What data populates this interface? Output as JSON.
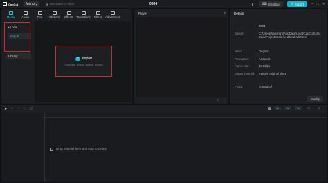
{
  "app": {
    "name": "CapCut",
    "menu_label": "Menu",
    "autosave_text": "Auto saved: 17:58:52",
    "project_title": "0504",
    "shortcut_label": "Shortcut",
    "export_label": "Export"
  },
  "media_tabs": [
    {
      "label": "Media",
      "icon": "media-icon"
    },
    {
      "label": "Audio",
      "icon": "audio-icon"
    },
    {
      "label": "Text",
      "icon": "text-icon"
    },
    {
      "label": "Stickers",
      "icon": "sticker-icon"
    },
    {
      "label": "Effects",
      "icon": "effects-icon"
    },
    {
      "label": "Transitions",
      "icon": "transitions-icon"
    },
    {
      "label": "Filters",
      "icon": "filters-icon"
    },
    {
      "label": "Adjustment",
      "icon": "adjustment-icon"
    }
  ],
  "sidebar": {
    "local": "• Local",
    "import": "Import",
    "library": "Library"
  },
  "import_box": {
    "label": "Import",
    "hint": "Supports: videos, audios, photos"
  },
  "player": {
    "title": "Player"
  },
  "details": {
    "title": "Details",
    "rows": [
      {
        "label": "",
        "value": "0504"
      },
      {
        "label": "Saved:",
        "value": "C:/Users/Nabong's/AppData/Local/CapCut/User Data/Projects/com.lveditor.draft/0504"
      },
      {
        "label": "Ratio:",
        "value": "Original"
      },
      {
        "label": "Resolution:",
        "value": "Adapted"
      },
      {
        "label": "Frame rate:",
        "value": "30.00fps"
      },
      {
        "label": "Import material:",
        "value": "Keep in original place"
      },
      {
        "label": "Proxy:",
        "value": "Turned off"
      }
    ],
    "modify_label": "Modify"
  },
  "timeline": {
    "drop_hint": "Drag material here and start to create"
  },
  "colors": {
    "accent": "#20c9d6",
    "export": "#14b2c4",
    "highlight_box": "#d42a2a"
  }
}
